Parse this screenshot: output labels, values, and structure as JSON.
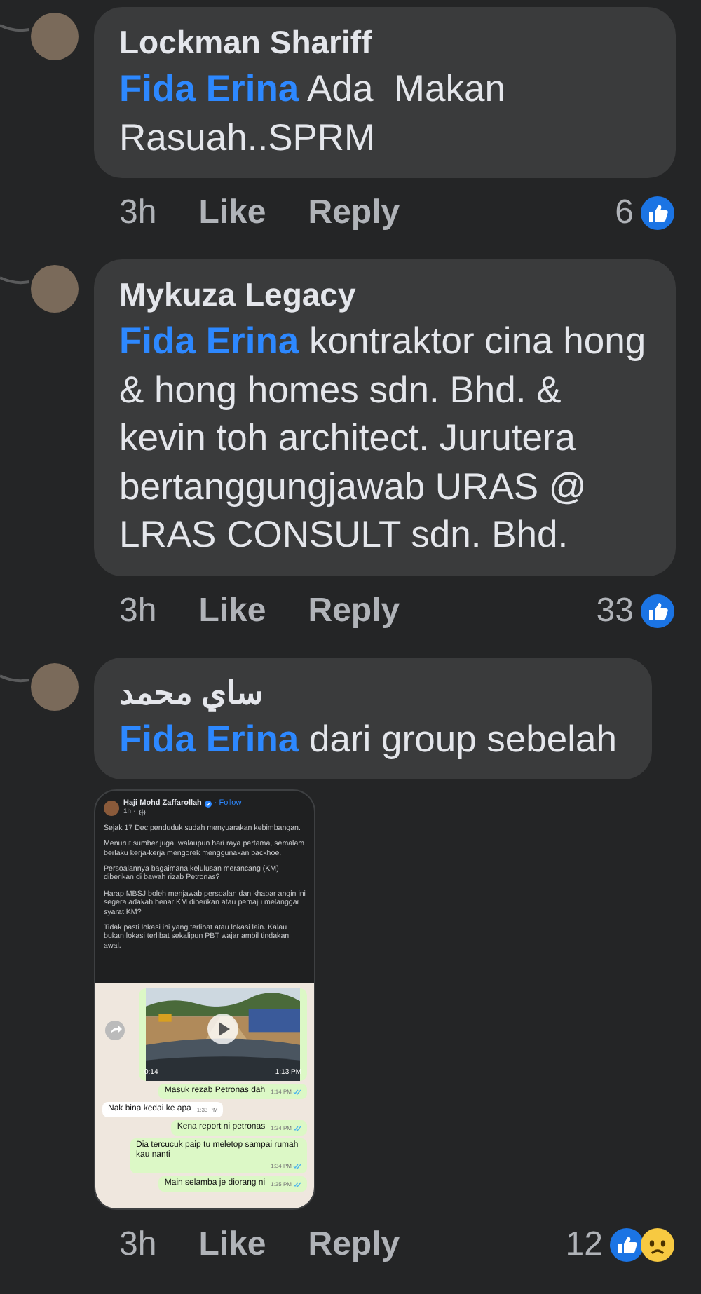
{
  "comments": [
    {
      "author": "Lockman Shariff",
      "mention": "Fida Erina",
      "text": "Ada  Makan Rasuah..SPRM",
      "time": "3h",
      "like": "Like",
      "reply": "Reply",
      "reaction_count": "6",
      "reactions": [
        {
          "kind": "like"
        }
      ]
    },
    {
      "author": "Mykuza Legacy",
      "mention": "Fida Erina",
      "text": "kontraktor cina hong & hong homes sdn. Bhd. & kevin toh architect. Jurutera bertanggungjawab URAS @ LRAS CONSULT sdn. Bhd.",
      "time": "3h",
      "like": "Like",
      "reply": "Reply",
      "reaction_count": "33",
      "reactions": [
        {
          "kind": "like"
        }
      ]
    },
    {
      "author": "ساي محمد",
      "mention": "Fida Erina",
      "text": "dari group sebelah",
      "time": "3h",
      "like": "Like",
      "reply": "Reply",
      "reaction_count": "12",
      "reactions": [
        {
          "kind": "like"
        },
        {
          "kind": "sad"
        }
      ],
      "attachment": {
        "post": {
          "author": "Haji Mohd Zaffarollah",
          "follow": "· Follow",
          "time": "1h ·",
          "paragraphs": [
            "Sejak 17 Dec penduduk sudah menyuarakan kebimbangan.",
            "Menurut sumber juga, walaupun hari raya pertama, semalam berlaku kerja-kerja mengorek menggunakan backhoe.",
            "Persoalannya bagaimana kelulusan merancang (KM) diberikan di bawah rizab Petronas?",
            "Harap MBSJ boleh menjawab persoalan dan khabar angin ini segera adakah benar KM diberikan atau pemaju melanggar syarat KM?",
            "Tidak pasti lokasi ini yang terlibat atau lokasi lain. Kalau bukan lokasi terlibat sekalipun PBT wajar ambil tindakan awal."
          ]
        },
        "chat": {
          "video_duration": "0:14",
          "video_time": "1:13 PM",
          "messages": [
            {
              "text": "Masuk rezab Petronas dah",
              "time": "1:14 PM",
              "outgoing": true
            },
            {
              "text": "Nak bina kedai ke apa",
              "time": "1:33 PM",
              "outgoing": false
            },
            {
              "text": "Kena report ni petronas",
              "time": "1:34 PM",
              "outgoing": true
            },
            {
              "text": "Dia tercucuk paip tu meletop sampai rumah kau nanti",
              "time": "1:34 PM",
              "outgoing": true
            },
            {
              "text": "Main selamba je diorang ni",
              "time": "1:35 PM",
              "outgoing": true
            }
          ]
        }
      }
    }
  ]
}
